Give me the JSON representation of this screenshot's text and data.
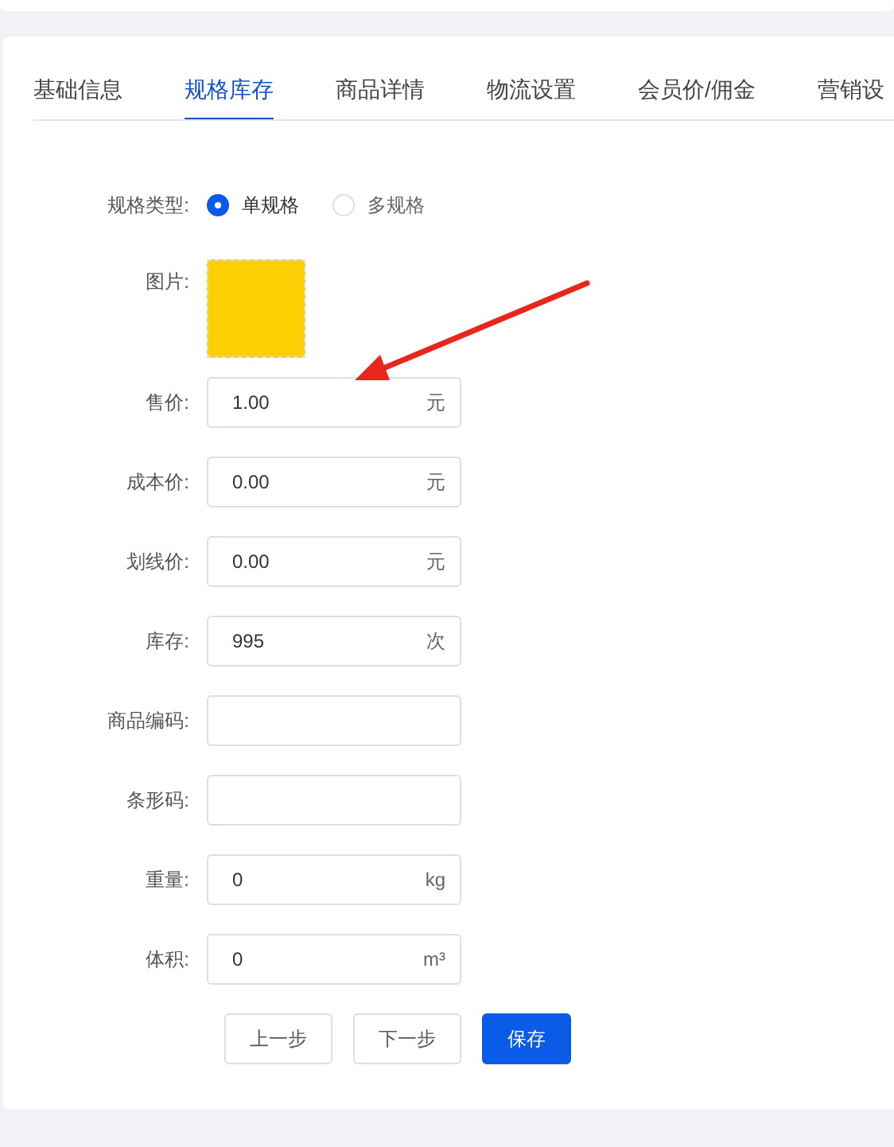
{
  "tabs": [
    {
      "label": "基础信息",
      "selected": false
    },
    {
      "label": "规格库存",
      "selected": true
    },
    {
      "label": "商品详情",
      "selected": false
    },
    {
      "label": "物流设置",
      "selected": false
    },
    {
      "label": "会员价/佣金",
      "selected": false
    },
    {
      "label": "营销设",
      "selected": false
    }
  ],
  "spec_type": {
    "label": "规格类型:",
    "options": [
      {
        "label": "单规格",
        "selected": true
      },
      {
        "label": "多规格",
        "selected": false
      }
    ]
  },
  "image": {
    "label": "图片:"
  },
  "fields": [
    {
      "label": "售价:",
      "value": "1.00",
      "unit": "元"
    },
    {
      "label": "成本价:",
      "value": "0.00",
      "unit": "元"
    },
    {
      "label": "划线价:",
      "value": "0.00",
      "unit": "元"
    },
    {
      "label": "库存:",
      "value": "995",
      "unit": "次"
    },
    {
      "label": "商品编码:"
    },
    {
      "label": "条形码:"
    },
    {
      "label": "重量:",
      "value": "0",
      "unit": "kg"
    },
    {
      "label": "体积:",
      "value": "0",
      "unit": "m³"
    }
  ],
  "buttons": [
    {
      "label": "上一步",
      "kind": "default"
    },
    {
      "label": "下一步",
      "kind": "default"
    },
    {
      "label": "保存",
      "kind": "primary"
    }
  ]
}
